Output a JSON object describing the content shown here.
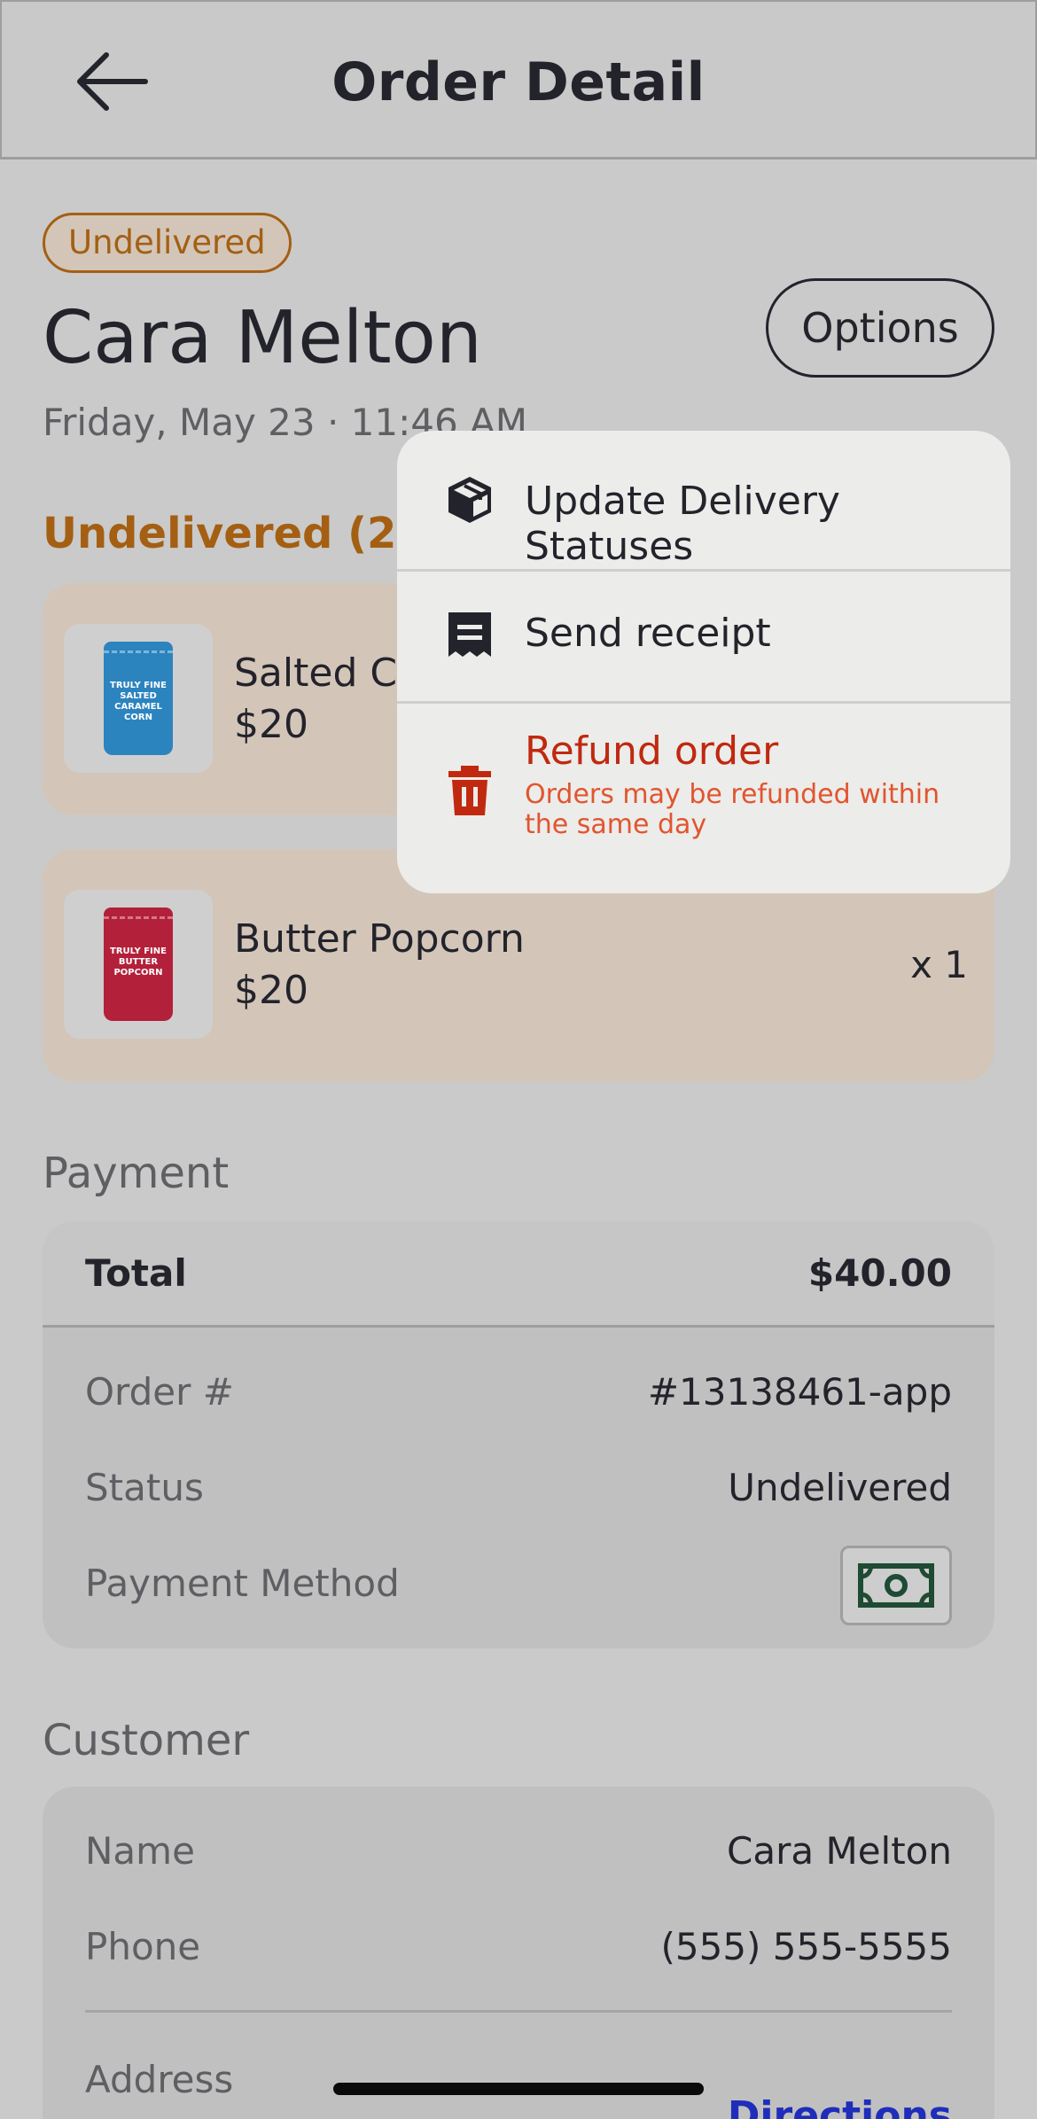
{
  "header": {
    "title": "Order Detail",
    "back_icon": "arrow-left-icon"
  },
  "order": {
    "status_pill": "Undelivered",
    "customer_name": "Cara Melton",
    "datetime": "Friday, May 23 · 11:46 AM",
    "options_label": "Options"
  },
  "undelivered": {
    "heading": "Undelivered (2)",
    "items": [
      {
        "name": "Salted Ca",
        "price": "$20",
        "qty": "",
        "bag_color": "#2c84bf",
        "bag_text": "TRULY FINE SALTED CARAMEL CORN"
      },
      {
        "name": "Butter Popcorn",
        "price": "$20",
        "qty": "x 1",
        "bag_color": "#b3203a",
        "bag_text": "TRULY FINE BUTTER POPCORN"
      }
    ]
  },
  "payment": {
    "heading": "Payment",
    "total_label": "Total",
    "total_value": "$40.00",
    "order_label": "Order #",
    "order_value": "#13138461-app",
    "status_label": "Status",
    "status_value": "Undelivered",
    "method_label": "Payment Method",
    "method_icon": "cash-icon"
  },
  "customer": {
    "heading": "Customer",
    "name_label": "Name",
    "name_value": "Cara Melton",
    "phone_label": "Phone",
    "phone_value": "(555) 555-5555",
    "address_label": "Address",
    "directions_label": "Directions"
  },
  "menu": {
    "items": [
      {
        "label": "Update Delivery Statuses",
        "icon": "package-icon"
      },
      {
        "label": "Send receipt",
        "icon": "receipt-icon"
      },
      {
        "label": "Refund order",
        "sub": "Orders may be refunded within the same day",
        "icon": "trash-icon"
      }
    ]
  },
  "colors": {
    "accent_orange": "#a45f13",
    "danger": "#c0290f",
    "link": "#1f2dbb"
  }
}
